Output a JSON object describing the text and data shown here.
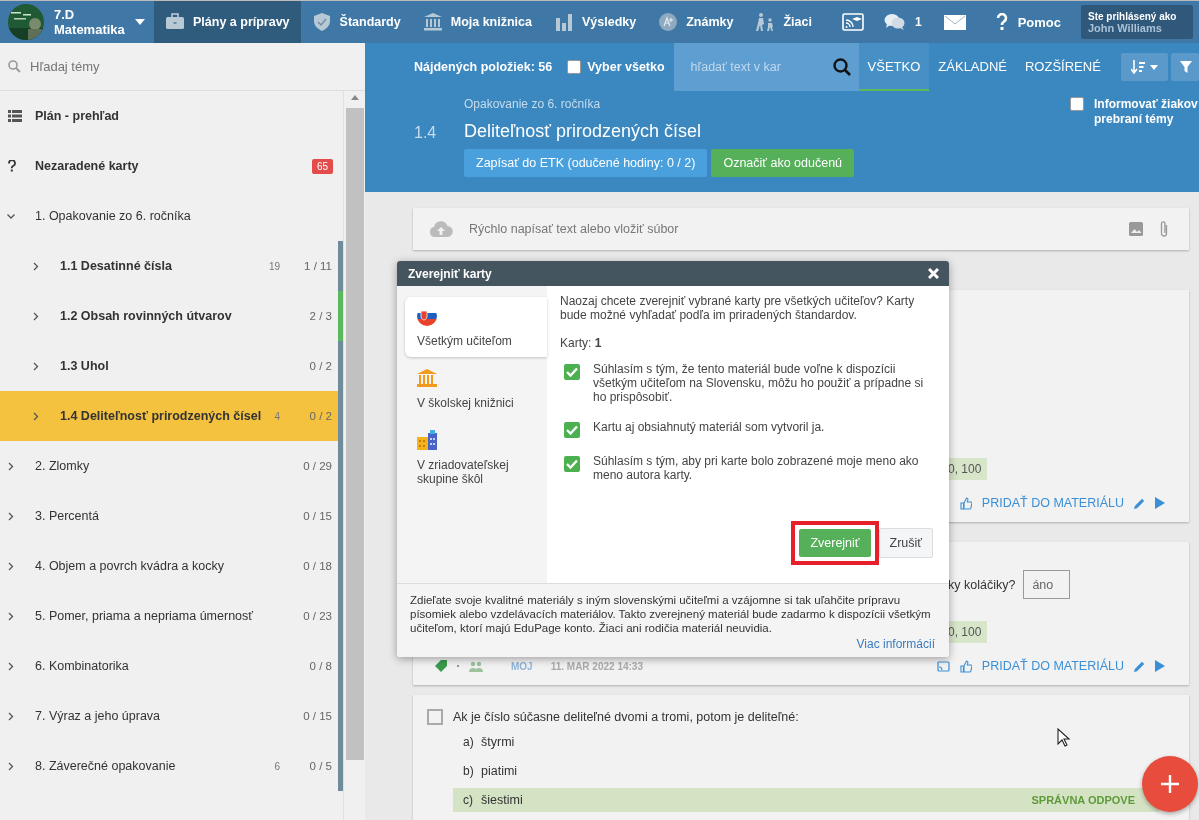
{
  "topbar": {
    "class_name": "7.D",
    "subject": "Matematika",
    "nav": [
      {
        "label": "Plány a prípravy",
        "selected": true
      },
      {
        "label": "Štandardy",
        "selected": false
      },
      {
        "label": "Moja knižnica",
        "selected": false
      },
      {
        "label": "Výsledky",
        "selected": false
      },
      {
        "label": "Známky",
        "selected": false
      },
      {
        "label": "Žiaci",
        "selected": false
      }
    ],
    "messages_count": "1",
    "help": "Pomoc",
    "user_caption": "Ste prihlásený ako",
    "user_name": "John Williams"
  },
  "sidebar": {
    "search_placeholder": "Hľadaj témy",
    "items": [
      {
        "kind": "overview",
        "label": "Plán - prehľad",
        "selected": false
      },
      {
        "kind": "unsorted",
        "label": "Nezaradené karty",
        "badge": "65",
        "selected": false
      },
      {
        "kind": "topic",
        "label": "1. Opakovanie zo 6. ročníka",
        "expanded": true,
        "selected": false,
        "children": [
          {
            "kind": "topic",
            "label": "1.1 Desatinné čísla",
            "count": "19",
            "progress": "1 / 11",
            "color": "#6f8c9c",
            "expanded": false,
            "selected": false
          },
          {
            "kind": "topic",
            "label": "1.2 Obsah rovinných útvarov",
            "progress": "2 / 3",
            "color": "#5cb85c",
            "expanded": false,
            "selected": false
          },
          {
            "kind": "topic",
            "label": "1.3 Uhol",
            "progress": "0 / 2",
            "color": "#6f8c9c",
            "expanded": false,
            "selected": false
          },
          {
            "kind": "topic",
            "label": "1.4 Deliteľnosť prirodzených čísel",
            "count": "4",
            "progress": "0 / 2",
            "color": "#6f8c9c",
            "expanded": false,
            "selected": true
          }
        ]
      },
      {
        "kind": "topic",
        "label": "2. Zlomky",
        "progress": "0 / 29",
        "color": "#6f8c9c",
        "expanded": false,
        "selected": false
      },
      {
        "kind": "topic",
        "label": "3. Percentá",
        "progress": "0 / 15",
        "color": "#6f8c9c",
        "expanded": false,
        "selected": false
      },
      {
        "kind": "topic",
        "label": "4. Objem a povrch kvádra a kocky",
        "progress": "0 / 18",
        "color": "#6f8c9c",
        "expanded": false,
        "selected": false
      },
      {
        "kind": "topic",
        "label": "5. Pomer, priama a nepriama úmernosť",
        "progress": "0 / 23",
        "color": "#6f8c9c",
        "expanded": false,
        "selected": false
      },
      {
        "kind": "topic",
        "label": "6. Kombinatorika",
        "progress": "0 / 8",
        "color": "#6f8c9c",
        "expanded": false,
        "selected": false
      },
      {
        "kind": "topic",
        "label": "7. Výraz a jeho úprava",
        "progress": "0 / 15",
        "color": "#6f8c9c",
        "expanded": false,
        "selected": false
      },
      {
        "kind": "topic",
        "label": "8. Záverečné opakovanie",
        "count": "6",
        "progress": "0 / 5",
        "color": "#6f8c9c",
        "expanded": false,
        "selected": false
      }
    ]
  },
  "header": {
    "found": "Nájdených položiek: 56",
    "select_all": {
      "label": "Vyber všetko",
      "checked": false
    },
    "search_placeholder": "hľadať text v kar",
    "tabs": [
      {
        "label": "VŠETKO",
        "selected": true
      },
      {
        "label": "ZÁKLADNÉ",
        "selected": false
      },
      {
        "label": "ROZŠÍRENÉ",
        "selected": false
      }
    ],
    "breadcrumb": "Opakovanie zo 6. ročníka",
    "number": "1.4",
    "title": "Deliteľnosť prirodzených čísel",
    "buttons": [
      {
        "label": "Zapísať do ETK (odučené hodiny: 0 / 2)",
        "kind": "primary"
      },
      {
        "label": "Označiť ako odučenú",
        "kind": "success"
      }
    ],
    "inform": {
      "label": "Informovať žiakov prebraní témy",
      "checked": false
    }
  },
  "composer": {
    "placeholder": "Rýchlo napísať text alebo vložiť súbor"
  },
  "cards": [
    {
      "kind": "partial",
      "tag": "0, 100",
      "action": "PRIDAŤ DO MATERIÁLU"
    },
    {
      "kind": "partial",
      "question_tail": "ky koláčiky?",
      "answer": "áno",
      "tag": "0, 100",
      "author": "MOJ",
      "date": "11. MAR 2022 14:33",
      "action": "PRIDAŤ DO MATERIÁLU"
    },
    {
      "kind": "choice",
      "checked": false,
      "question": "Ak je číslo súčasne deliteľné dvomi a tromi, potom je deliteľné:",
      "options": [
        {
          "letter": "a)",
          "text": "štyrmi",
          "correct": false
        },
        {
          "letter": "b)",
          "text": "piatimi",
          "correct": false
        },
        {
          "letter": "c)",
          "text": "šiestimi",
          "correct": true,
          "note": "SPRÁVNA ODPOVE"
        }
      ]
    }
  ],
  "dialog": {
    "title": "Zverejniť karty",
    "targets": [
      {
        "label": "Všetkým učiteľom",
        "selected": true
      },
      {
        "label": "V školskej knižnici",
        "selected": false
      },
      {
        "label": "V zriadovateľskej skupine škôl",
        "selected": false
      }
    ],
    "intro": "Naozaj chcete zverejniť vybrané karty pre všetkých učiteľov? Karty bude možné vyhľadať podľa im priradených štandardov.",
    "count": "Karty: **1**",
    "agreements": [
      {
        "label": "Súhlasím s tým, že tento materiál bude voľne k dispozícii všetkým učiteľom na Slovensku, môžu ho použiť a prípadne si ho prispôsobiť.",
        "checked": true
      },
      {
        "label": "Kartu aj obsiahnutý materiál som vytvoril ja.",
        "checked": true
      },
      {
        "label": "Súhlasím s tým, aby pri karte bolo zobrazené moje meno ako meno autora karty.",
        "checked": true
      }
    ],
    "publish": "Zverejniť",
    "cancel": "Zrušiť",
    "footer": "Zdieľate svoje kvalitné materiály s iným slovenskými učiteľmi a vzájomne si tak uľahčite prípravu písomiek alebo vzdelávacích materiálov. Takto zverejnený materiál bude zadarmo k dispozícii všetkým učiteľom, ktorí majú EduPage konto. Žiaci ani rodičia materiál neuvidia.",
    "more": "Viac informácií"
  }
}
